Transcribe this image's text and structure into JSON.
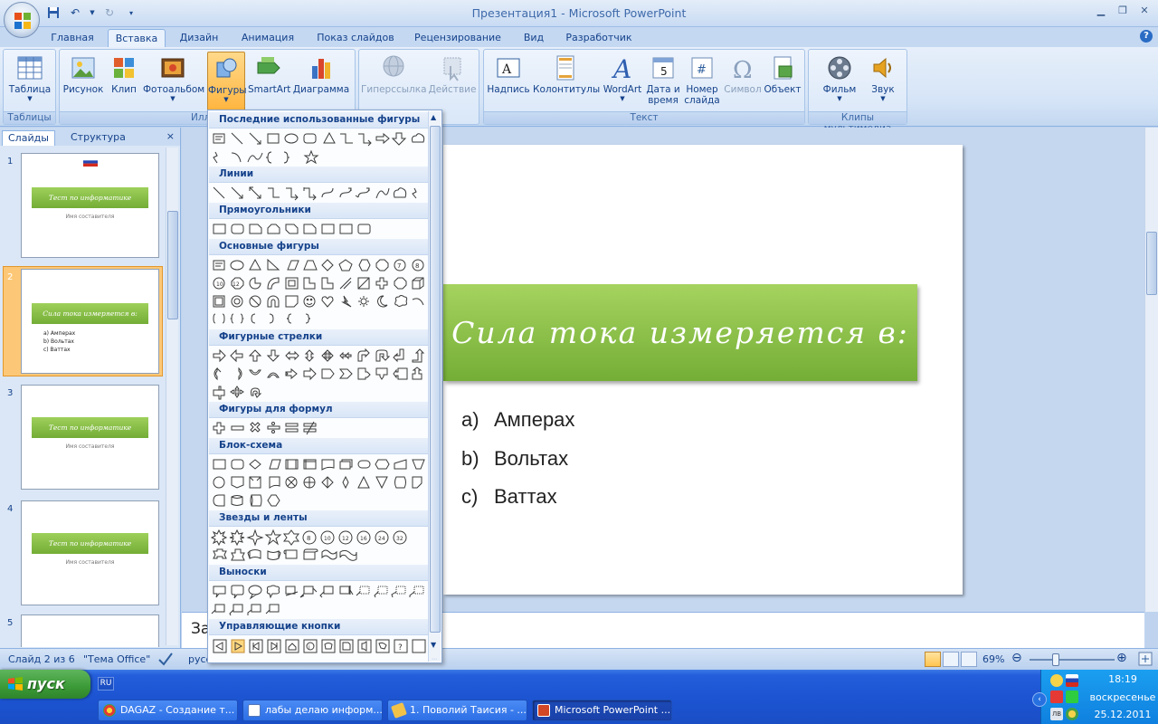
{
  "window": {
    "title": "Презентация1 - Microsoft PowerPoint"
  },
  "tabs": [
    "Главная",
    "Вставка",
    "Дизайн",
    "Анимация",
    "Показ слайдов",
    "Рецензирование",
    "Вид",
    "Разработчик"
  ],
  "active_tab": "Вставка",
  "ribbon": {
    "groups": {
      "tables": "Таблицы",
      "illustrations": "Иллюс",
      "text": "Текст",
      "media": "Клипы мультимедиа"
    },
    "buttons": {
      "table": "Таблица",
      "picture": "Рисунок",
      "clip": "Клип",
      "photoalbum": "Фотоальбом",
      "shapes": "Фигуры",
      "smartart": "SmartArt",
      "chart": "Диаграмма",
      "hyperlink": "Гиперссылка",
      "action": "Действие",
      "textbox": "Надпись",
      "header_footer": "Колонтитулы",
      "wordart": "WordArt",
      "datetime_1": "Дата и",
      "datetime_2": "время",
      "slide_number_1": "Номер",
      "slide_number_2": "слайда",
      "symbol": "Символ",
      "object": "Объект",
      "movie": "Фильм",
      "sound": "Звук"
    }
  },
  "left_panel": {
    "tab_slides": "Слайды",
    "tab_outline": "Структура",
    "close": "×",
    "slides": [
      {
        "num": "1",
        "title": "Тест по информатике",
        "sub": "Имя составителя"
      },
      {
        "num": "2",
        "title": "Сила тока измеряется в:",
        "items": [
          "a) Амперах",
          "b) Вольтах",
          "c) Ваттах"
        ]
      },
      {
        "num": "3",
        "title": "Тест по информатике",
        "sub": "Имя составителя"
      },
      {
        "num": "4",
        "title": "Тест по информатике",
        "sub": "Имя составителя"
      },
      {
        "num": "5"
      }
    ]
  },
  "slide": {
    "title": "Сила тока измеряется в:",
    "answers": [
      {
        "letter": "a)",
        "text": "Амперах"
      },
      {
        "letter": "b)",
        "text": "Вольтах"
      },
      {
        "letter": "c)",
        "text": "Ваттах"
      }
    ]
  },
  "notes": {
    "text": "За"
  },
  "shapes_menu": {
    "categories": [
      "Последние использованные фигуры",
      "Линии",
      "Прямоугольники",
      "Основные фигуры",
      "Фигурные стрелки",
      "Фигуры для формул",
      "Блок-схема",
      "Звезды и ленты",
      "Выноски",
      "Управляющие кнопки"
    ]
  },
  "status": {
    "slide_info": "Слайд 2 из 6",
    "theme": "\"Тема Office\"",
    "language": "русс",
    "zoom": "69%"
  },
  "taskbar": {
    "start": "пуск",
    "lang": "RU",
    "tasks": [
      "DAGAZ - Создание т...",
      "лабы делаю информ...",
      "1. Поволий Таисия - ...",
      "Microsoft PowerPoint ..."
    ],
    "time": "18:19",
    "weekday": "воскресенье",
    "date": "25.12.2011"
  }
}
